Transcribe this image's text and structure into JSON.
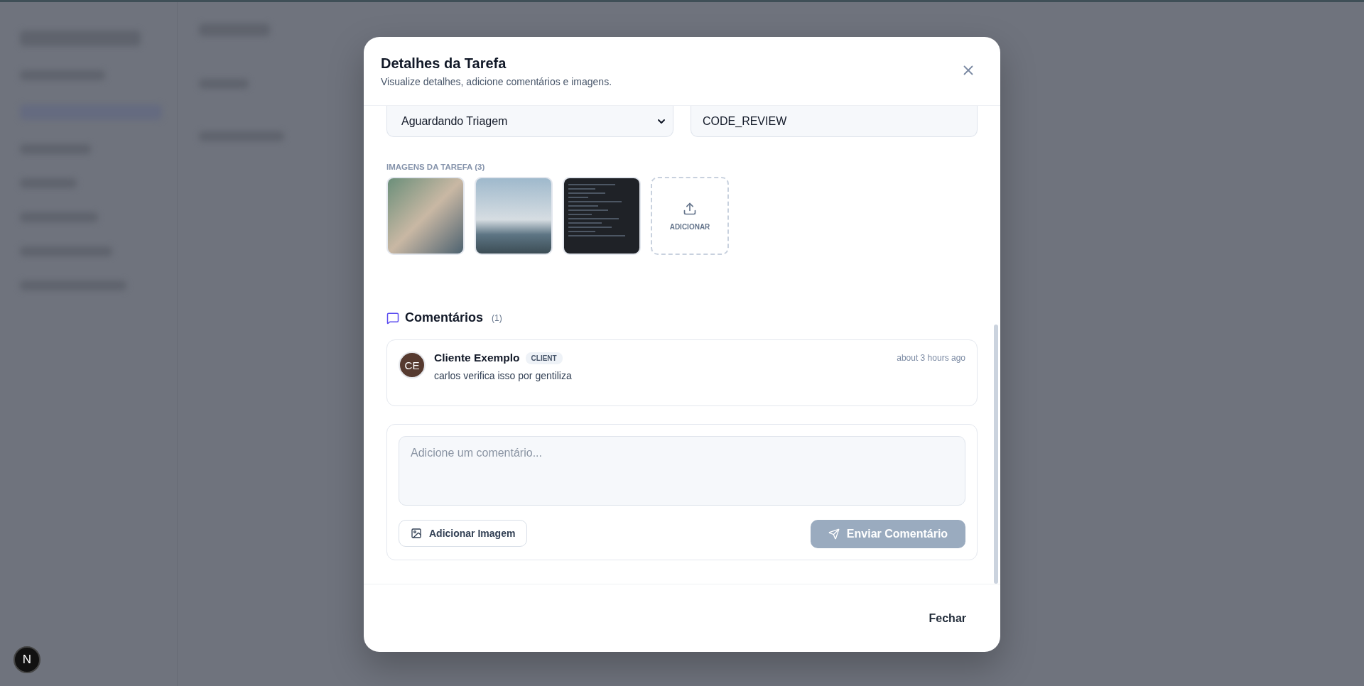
{
  "dialog": {
    "title": "Detalhes da Tarefa",
    "subtitle": "Visualize detalhes, adicione comentários e imagens."
  },
  "fields": {
    "status": "Aguardando Triagem",
    "stage": "CODE_REVIEW"
  },
  "images": {
    "label": "IMAGENS DA TAREFA (3)",
    "items": [
      {
        "kind": "photo"
      },
      {
        "kind": "photo"
      },
      {
        "kind": "screenshot"
      }
    ],
    "add_label": "ADICIONAR"
  },
  "comments": {
    "title": "Comentários",
    "count": "(1)",
    "items": [
      {
        "initials": "CE",
        "author": "Cliente Exemplo",
        "role": "CLIENT",
        "time": "about 3 hours ago",
        "text": "carlos verifica isso por gentiliza"
      }
    ]
  },
  "composer": {
    "placeholder": "Adicione um comentário...",
    "image_button": "Adicionar Imagem",
    "send_button": "Enviar Comentário",
    "send_disabled": true
  },
  "footer": {
    "close_button": "Fechar"
  },
  "dev_badge": "N"
}
